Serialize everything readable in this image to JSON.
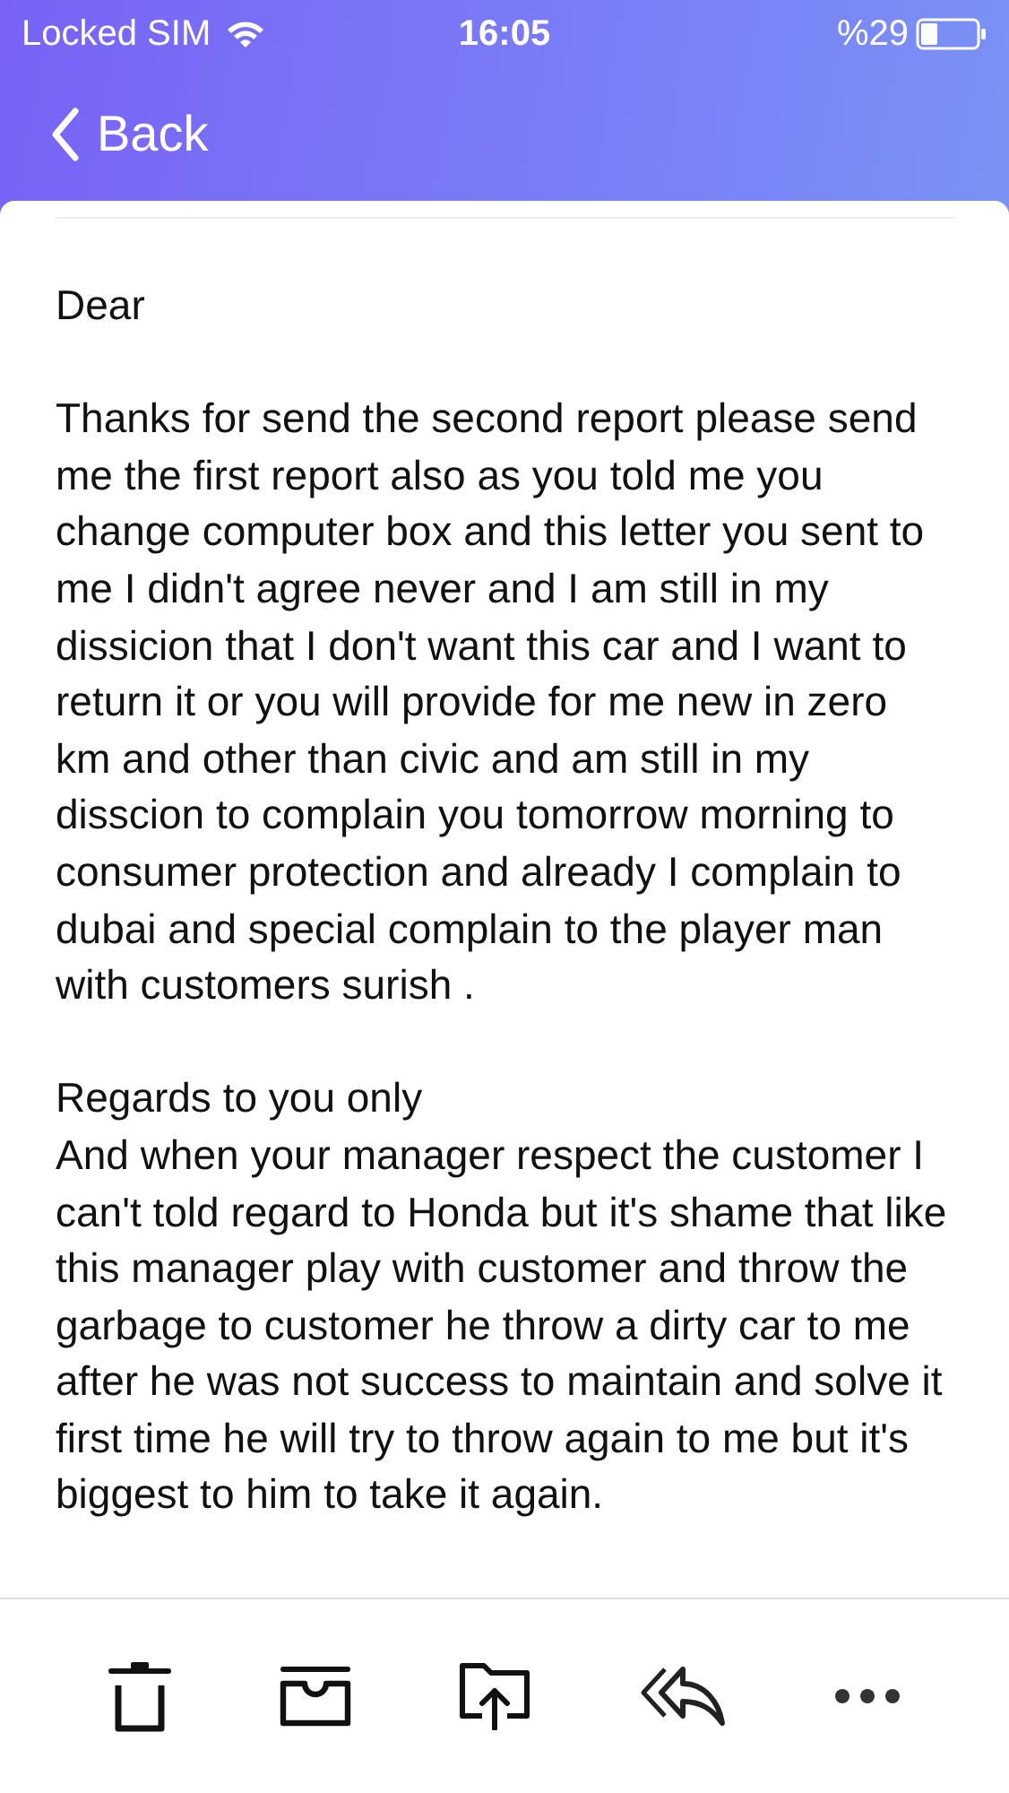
{
  "status_bar": {
    "carrier": "Locked SIM",
    "time": "16:05",
    "battery": "%29"
  },
  "nav": {
    "back": "Back"
  },
  "message": {
    "sections": [
      [
        "Dear"
      ],
      [
        "Thanks for send the second report please send me the first report also as you told me you change computer box and this letter you sent to me I didn't agree never and I am still in my dissicion that I don't want this car and I want to return it or you will provide for me new in zero km and other than civic and am still in my disscion to complain you tomorrow morning to consumer protection and already I complain to dubai and special complain to the player man with customers surish ."
      ],
      [
        "Regards to you only",
        "And when your manager respect the customer I can't told regard to Honda but it's shame that like this manager play with customer and throw the garbage to customer he throw a dirty car to me after he was not success to maintain and solve it first time he will try to throw again to me but it's biggest to him to take it again."
      ]
    ]
  }
}
